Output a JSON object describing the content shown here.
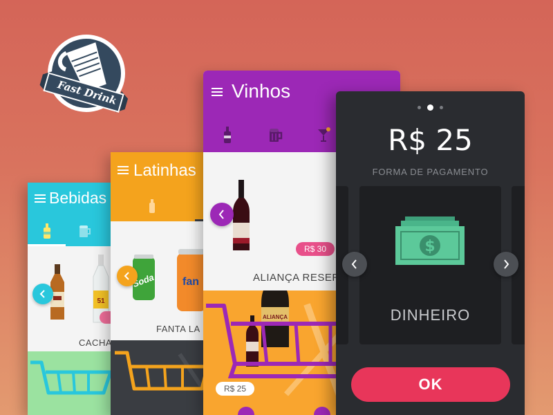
{
  "logo": {
    "text": "Fast Drink",
    "icon": "drink-glass-icon"
  },
  "cards": {
    "bebidas": {
      "title": "Bebidas",
      "color": "#29c7dc",
      "tabs": [
        "bottle-icon",
        "beer-mug-icon"
      ],
      "product_name": "CACHAÇ"
    },
    "latinhas": {
      "title": "Latinhas",
      "color": "#f4a31d",
      "tabs": [
        "bottle-icon"
      ],
      "product_name": "FANTA LA"
    },
    "vinhos": {
      "title": "Vinhos",
      "color": "#9c28b6",
      "tabs": [
        "bottle-icon",
        "beer-mug-icon",
        "cocktail-icon"
      ],
      "product_name": "ALIANÇA RESER",
      "price": "R$ 30",
      "cart_price": "R$ 25"
    }
  },
  "payment": {
    "amount": "R$ 25",
    "label": "FORMA DE PAGAMENTO",
    "method": "DINHEIRO",
    "method_icon": "cash-icon",
    "ok_label": "OK",
    "page_dots": [
      false,
      true,
      false
    ],
    "accent": "#e8365a"
  }
}
